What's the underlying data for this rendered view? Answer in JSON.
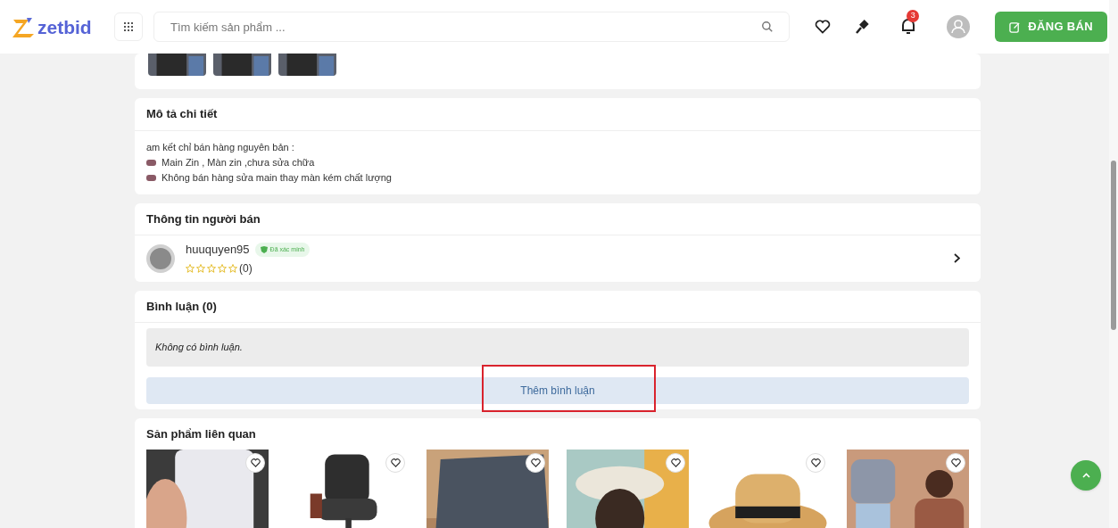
{
  "header": {
    "logo": "zetbid",
    "search": {
      "placeholder": "Tìm kiếm sản phẩm ..."
    },
    "notification_count": "3",
    "post_button": "ĐĂNG BÁN"
  },
  "description": {
    "title": "Mô tả chi tiết",
    "lines": [
      {
        "kind": "text",
        "text": "am kết chỉ bán hàng nguyên bản :"
      },
      {
        "kind": "bullet",
        "text": "Main Zin , Màn zin ,chưa sửa chữa"
      },
      {
        "kind": "bullet",
        "text": "Không bán hàng sửa main thay màn kém chất lượng"
      }
    ]
  },
  "seller": {
    "title": "Thông tin người bán",
    "username": "huuquyen95",
    "verified": true,
    "verified_label": "Đã xác minh",
    "stars": 0,
    "rating_count": "(0)"
  },
  "comments": {
    "title": "Bình luận (0)",
    "empty_text": "Không có bình luận.",
    "add_button": "Thêm bình luận",
    "highlighted": true
  },
  "related": {
    "title": "Sản phẩm liên quan",
    "products": [
      {
        "kind": "phone",
        "favorite": false
      },
      {
        "kind": "chair",
        "favorite": false
      },
      {
        "kind": "laptop",
        "favorite": false
      },
      {
        "kind": "bucket-hat",
        "favorite": false
      },
      {
        "kind": "straw-hat",
        "favorite": false
      },
      {
        "kind": "clothing",
        "favorite": false
      }
    ]
  }
}
